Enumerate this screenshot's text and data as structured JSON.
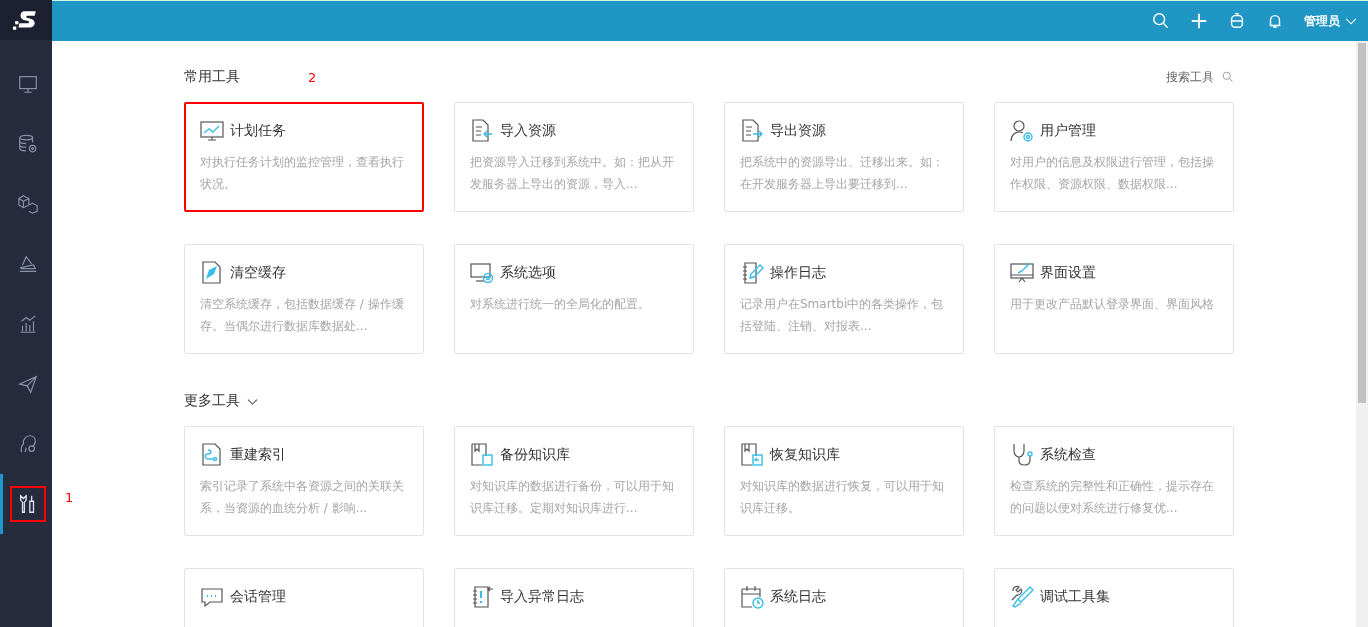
{
  "header": {
    "user": "管理员"
  },
  "sidebar": {
    "items": [
      {
        "selected": false
      },
      {
        "selected": false
      },
      {
        "selected": false
      },
      {
        "selected": false
      },
      {
        "selected": false
      },
      {
        "selected": false
      },
      {
        "selected": false
      },
      {
        "selected": true,
        "callout": "1"
      }
    ]
  },
  "sections": [
    {
      "title": "常用工具",
      "search_label": "搜索工具",
      "cards": [
        {
          "title": "计划任务",
          "description": "对执行任务计划的监控管理，查看执行状况。",
          "callout": "2"
        },
        {
          "title": "导入资源",
          "description": "把资源导入迁移到系统中。如：把从开发服务器上导出的资源，导入..."
        },
        {
          "title": "导出资源",
          "description": "把系统中的资源导出、迁移出来。如：在开发服务器上导出要迁移到..."
        },
        {
          "title": "用户管理",
          "description": "对用户的信息及权限进行管理，包括操作权限、资源权限、数据权限..."
        },
        {
          "title": "清空缓存",
          "description": "清空系统缓存，包括数据缓存 / 操作缓存。当偶尔进行数据库数据处..."
        },
        {
          "title": "系统选项",
          "description": "对系统进行统一的全局化的配置。"
        },
        {
          "title": "操作日志",
          "description": "记录用户在Smartbi中的各类操作，包括登陆、注销、对报表..."
        },
        {
          "title": "界面设置",
          "description": "用于更改产品默认登录界面、界面风格"
        }
      ]
    },
    {
      "title": "更多工具",
      "expanded": true,
      "cards": [
        {
          "title": "重建索引",
          "description": "索引记录了系统中各资源之间的关联关系，当资源的血统分析 / 影响..."
        },
        {
          "title": "备份知识库",
          "description": "对知识库的数据进行备份，可以用于知识库迁移。定期对知识库进行..."
        },
        {
          "title": "恢复知识库",
          "description": "对知识库的数据进行恢复，可以用于知识库迁移。"
        },
        {
          "title": "系统检查",
          "description": "检查系统的完整性和正确性，提示存在的问题以便对系统进行修复优..."
        },
        {
          "title": "会话管理"
        },
        {
          "title": "导入异常日志"
        },
        {
          "title": "系统日志"
        },
        {
          "title": "调试工具集"
        }
      ]
    }
  ]
}
